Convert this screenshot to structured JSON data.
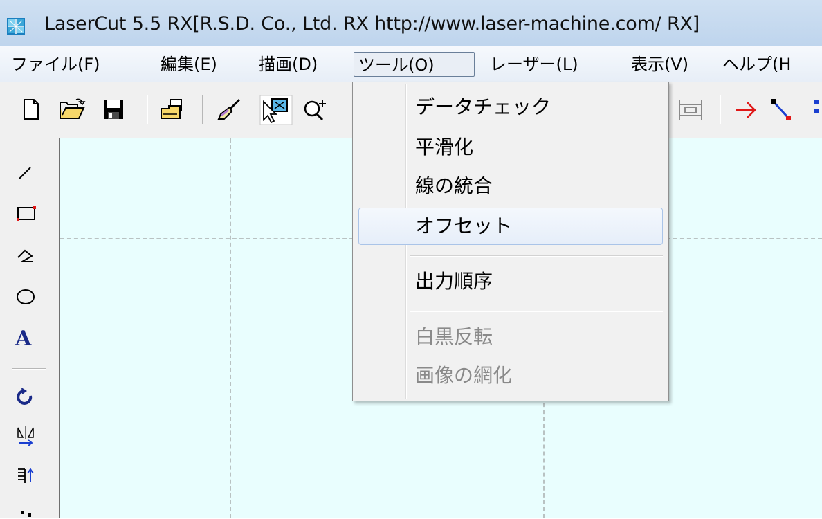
{
  "window": {
    "title": "LaserCut 5.5 RX[R.S.D. Co., Ltd. RX http://www.laser-machine.com/ RX]"
  },
  "menubar": {
    "items": [
      {
        "label": "ファイル(F)"
      },
      {
        "label": "編集(E)"
      },
      {
        "label": "描画(D)"
      },
      {
        "label": "ツール(O)",
        "active": true
      },
      {
        "label": "レーザー(L)"
      },
      {
        "label": "表示(V)"
      },
      {
        "label": "ヘルプ(H"
      }
    ]
  },
  "tools_menu": {
    "items": [
      {
        "label": "データチェック",
        "enabled": true
      },
      {
        "label": "平滑化",
        "enabled": true
      },
      {
        "label": "線の統合",
        "enabled": true
      },
      {
        "label": "オフセット",
        "enabled": true,
        "hovered": true
      },
      {
        "label": "出力順序",
        "enabled": true
      },
      {
        "label": "白黒反転",
        "enabled": false
      },
      {
        "label": "画像の網化",
        "enabled": false
      }
    ]
  },
  "toolbar": {
    "icons": [
      "new-file-icon",
      "open-folder-icon",
      "save-icon",
      "print-icon",
      "brush-icon",
      "select-icon",
      "zoom-icon",
      "layout-icon",
      "arrow-icon",
      "path-icon"
    ]
  },
  "left_toolbar": {
    "text_tool_glyph": "A"
  },
  "colors": {
    "canvas": "#e9fefe",
    "highlight_border": "#aac4e8"
  }
}
